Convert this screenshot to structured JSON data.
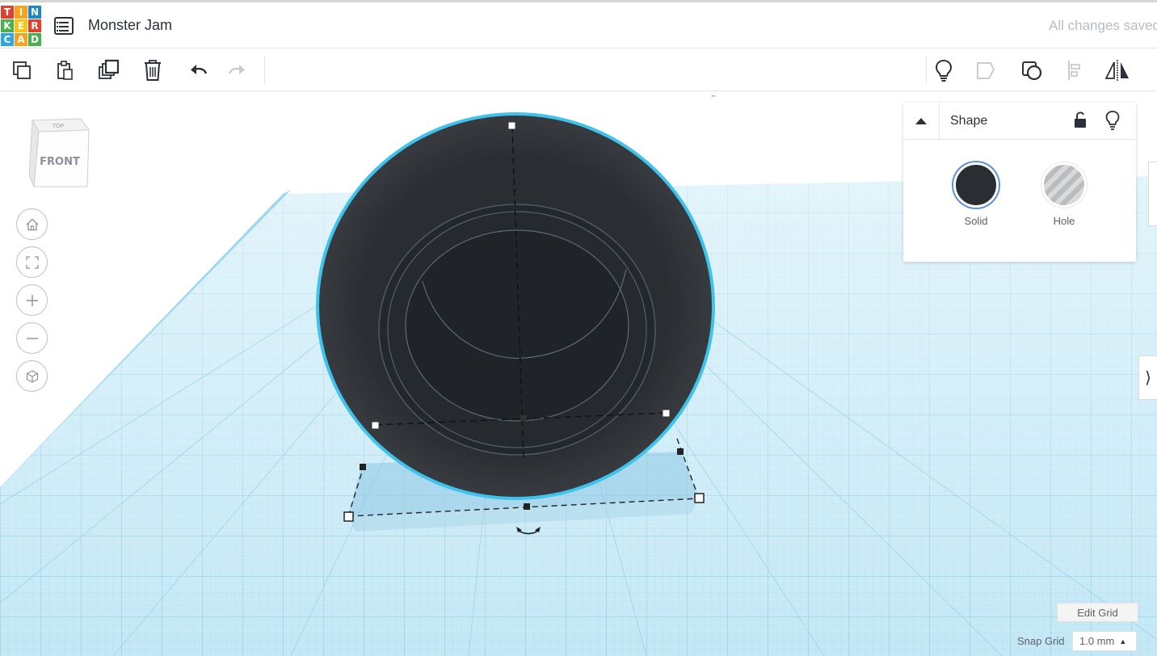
{
  "app": {
    "logo_letters": [
      "T",
      "I",
      "N",
      "K",
      "E",
      "R",
      "C",
      "A",
      "D"
    ],
    "document_title": "Monster Jam",
    "save_status": "All changes saved"
  },
  "toolbar": {
    "left": [
      {
        "name": "copy",
        "icon": "copy-icon"
      },
      {
        "name": "paste",
        "icon": "paste-icon"
      },
      {
        "name": "duplicate",
        "icon": "duplicate-icon"
      },
      {
        "name": "delete",
        "icon": "trash-icon"
      },
      {
        "name": "undo",
        "icon": "undo-icon"
      },
      {
        "name": "redo",
        "icon": "redo-icon",
        "disabled": true
      }
    ],
    "right": [
      {
        "name": "show-all",
        "icon": "lightbulb-icon"
      },
      {
        "name": "group",
        "icon": "group-icon",
        "disabled": true
      },
      {
        "name": "ungroup",
        "icon": "ungroup-icon"
      },
      {
        "name": "align",
        "icon": "align-icon",
        "disabled": true
      },
      {
        "name": "mirror",
        "icon": "mirror-icon"
      }
    ]
  },
  "viewcube": {
    "top_label": "TOP",
    "front_label": "FRONT"
  },
  "navigation": [
    {
      "name": "home-view",
      "icon": "home-icon"
    },
    {
      "name": "fit-view",
      "icon": "fit-icon"
    },
    {
      "name": "zoom-in",
      "icon": "plus-icon"
    },
    {
      "name": "zoom-out",
      "icon": "minus-icon"
    },
    {
      "name": "perspective",
      "icon": "cube-icon"
    }
  ],
  "shape_panel": {
    "title": "Shape",
    "lock_icon": "unlock-icon",
    "visibility_icon": "lightbulb-icon",
    "options": [
      {
        "label": "Solid",
        "selected": true,
        "color": "#2a2d31"
      },
      {
        "label": "Hole",
        "selected": false
      }
    ]
  },
  "grid": {
    "edit_label": "Edit Grid",
    "snap_label": "Snap Grid",
    "snap_value": "1.0 mm"
  },
  "colors": {
    "workplane": "#bfe6f5",
    "grid_line": "#8ecde6",
    "selection_outline": "#3fc3ec",
    "shape": "#2d3135"
  }
}
